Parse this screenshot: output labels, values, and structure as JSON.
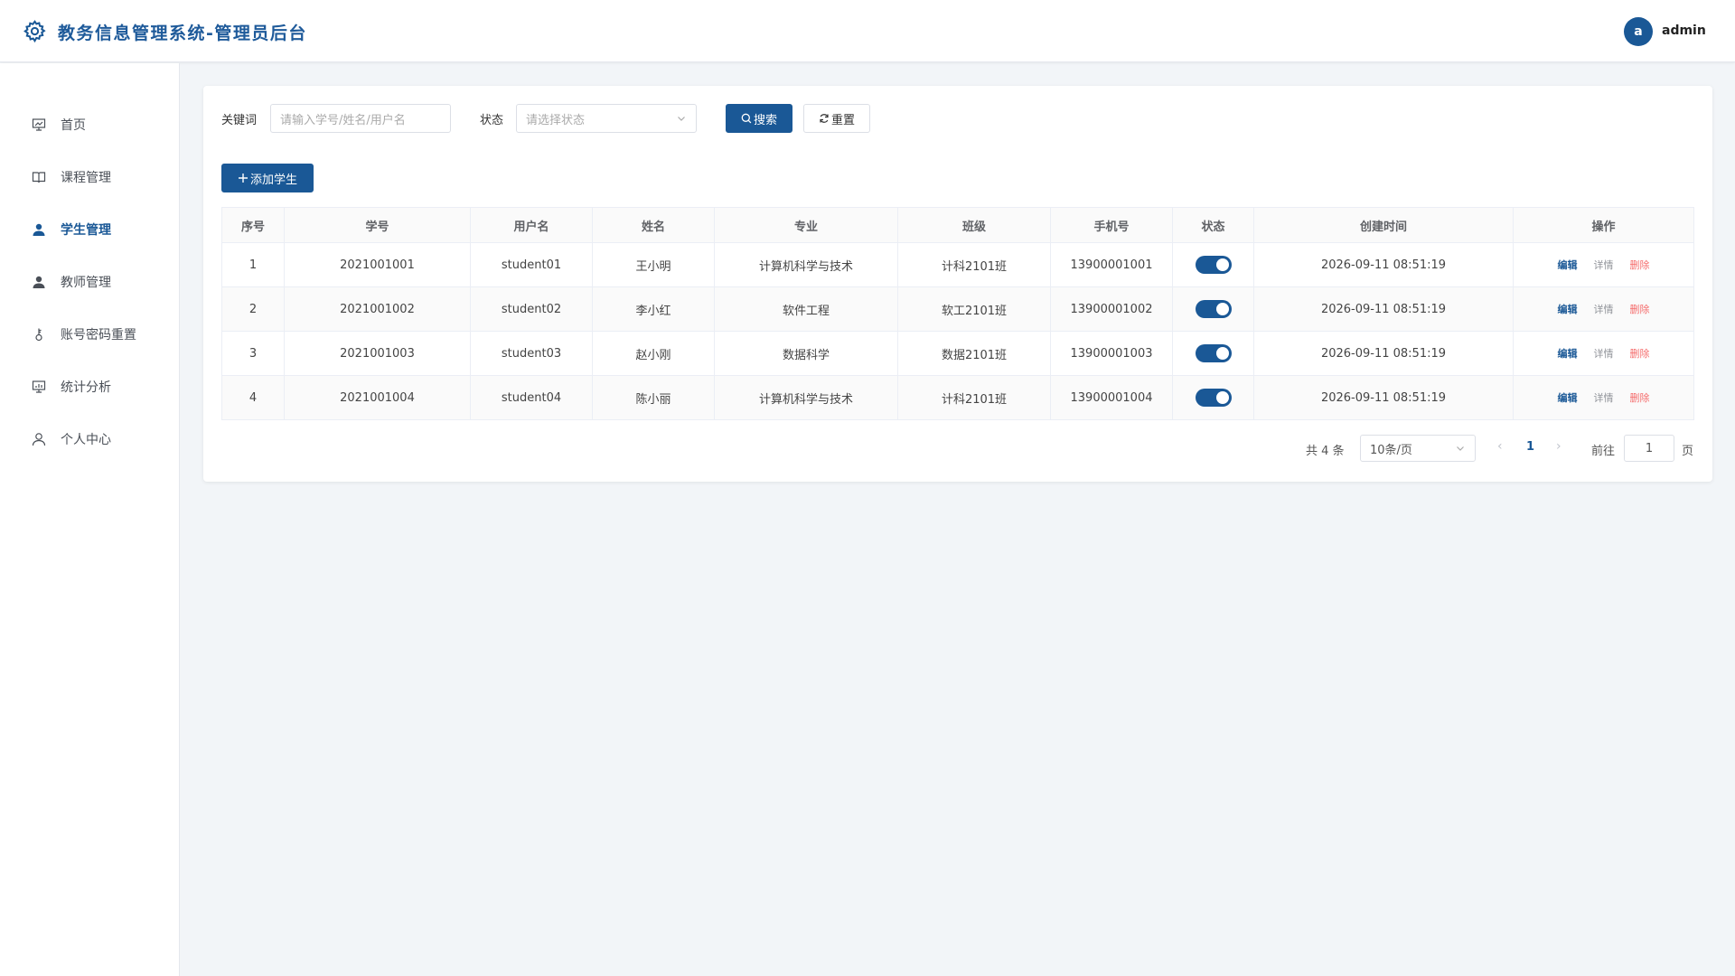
{
  "header": {
    "app_title": "教务信息管理系统-管理员后台",
    "avatar_initial": "a",
    "username": "admin"
  },
  "sidebar": {
    "items": [
      {
        "label": "首页",
        "icon": "presentation-icon",
        "active": false
      },
      {
        "label": "课程管理",
        "icon": "book-icon",
        "active": false
      },
      {
        "label": "学生管理",
        "icon": "user-icon",
        "active": true
      },
      {
        "label": "教师管理",
        "icon": "user-icon",
        "active": false
      },
      {
        "label": "账号密码重置",
        "icon": "key-icon",
        "active": false
      },
      {
        "label": "统计分析",
        "icon": "chart-board-icon",
        "active": false
      },
      {
        "label": "个人中心",
        "icon": "user-outline-icon",
        "active": false
      }
    ]
  },
  "filters": {
    "keyword_label": "关键词",
    "keyword_placeholder": "请输入学号/姓名/用户名",
    "status_label": "状态",
    "status_placeholder": "请选择状态",
    "search_label": "搜索",
    "reset_label": "重置"
  },
  "add_button_label": "添加学生",
  "table": {
    "headers": [
      "序号",
      "学号",
      "用户名",
      "姓名",
      "专业",
      "班级",
      "手机号",
      "状态",
      "创建时间",
      "操作"
    ],
    "rows": [
      {
        "index": "1",
        "student_no": "2021001001",
        "username": "student01",
        "name": "王小明",
        "major": "计算机科学与技术",
        "class": "计科2101班",
        "phone": "13900001001",
        "enabled": true,
        "created": "2026-09-11 08:51:19"
      },
      {
        "index": "2",
        "student_no": "2021001002",
        "username": "student02",
        "name": "李小红",
        "major": "软件工程",
        "class": "软工2101班",
        "phone": "13900001002",
        "enabled": true,
        "created": "2026-09-11 08:51:19"
      },
      {
        "index": "3",
        "student_no": "2021001003",
        "username": "student03",
        "name": "赵小刚",
        "major": "数据科学",
        "class": "数据2101班",
        "phone": "13900001003",
        "enabled": true,
        "created": "2026-09-11 08:51:19"
      },
      {
        "index": "4",
        "student_no": "2021001004",
        "username": "student04",
        "name": "陈小丽",
        "major": "计算机科学与技术",
        "class": "计科2101班",
        "phone": "13900001004",
        "enabled": true,
        "created": "2026-09-11 08:51:19"
      }
    ],
    "actions": {
      "edit": "编辑",
      "detail": "详情",
      "delete": "删除"
    }
  },
  "pagination": {
    "total_text": "共 4 条",
    "page_size": "10条/页",
    "current_page": "1",
    "goto_label": "前往",
    "goto_value": "1",
    "page_unit": "页"
  },
  "colors": {
    "primary": "#1a5896",
    "danger": "#f56c6c",
    "background": "#f2f5f8"
  }
}
